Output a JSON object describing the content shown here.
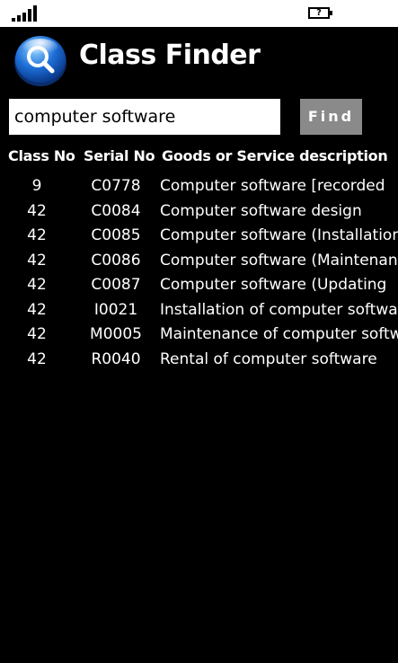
{
  "status_bar": {
    "battery_glyph": "?",
    "icons": [
      "signal-icon",
      "battery-icon"
    ]
  },
  "header": {
    "title": "Class Finder",
    "logo_icon": "search-icon",
    "colors": {
      "logo_blue": "#1d6fd8",
      "logo_light": "#8fd0ff"
    }
  },
  "search": {
    "value": "computer software",
    "button_label": "Find"
  },
  "table": {
    "columns": [
      "Class No",
      "Serial No",
      "Goods or Service description"
    ],
    "rows": [
      {
        "class_no": "9",
        "serial_no": "C0778",
        "description": "Computer software [recorded"
      },
      {
        "class_no": "42",
        "serial_no": "C0084",
        "description": "Computer software design"
      },
      {
        "class_no": "42",
        "serial_no": "C0085",
        "description": "Computer software (Installation"
      },
      {
        "class_no": "42",
        "serial_no": "C0086",
        "description": "Computer software (Maintenance"
      },
      {
        "class_no": "42",
        "serial_no": "C0087",
        "description": "Computer software (Updating"
      },
      {
        "class_no": "42",
        "serial_no": "I0021",
        "description": "Installation of computer software"
      },
      {
        "class_no": "42",
        "serial_no": "M0005",
        "description": "Maintenance of computer software"
      },
      {
        "class_no": "42",
        "serial_no": "R0040",
        "description": "Rental of computer software"
      }
    ]
  }
}
